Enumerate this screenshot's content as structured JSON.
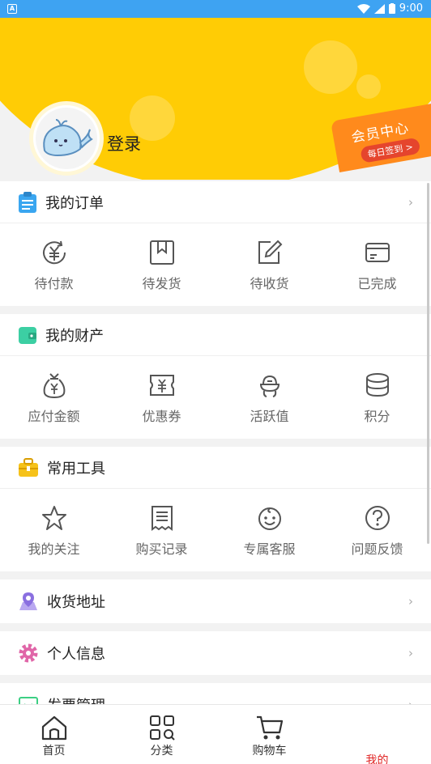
{
  "status_bar": {
    "time": "9:00"
  },
  "header": {
    "login_label": "登录",
    "vip_title": "会员中心",
    "vip_sub": "每日签到 >"
  },
  "orders": {
    "title": "我的订单",
    "items": [
      {
        "label": "待付款",
        "icon": "payment-icon"
      },
      {
        "label": "待发货",
        "icon": "package-icon"
      },
      {
        "label": "待收货",
        "icon": "edit-icon"
      },
      {
        "label": "已完成",
        "icon": "card-icon"
      }
    ]
  },
  "assets": {
    "title": "我的财产",
    "items": [
      {
        "label": "应付金额",
        "icon": "money-bag-icon"
      },
      {
        "label": "优惠券",
        "icon": "coupon-icon"
      },
      {
        "label": "活跃值",
        "icon": "activity-icon"
      },
      {
        "label": "积分",
        "icon": "coins-icon"
      }
    ]
  },
  "tools": {
    "title": "常用工具",
    "items": [
      {
        "label": "我的关注",
        "icon": "star-icon"
      },
      {
        "label": "购买记录",
        "icon": "receipt-icon"
      },
      {
        "label": "专属客服",
        "icon": "smile-icon"
      },
      {
        "label": "问题反馈",
        "icon": "question-icon"
      }
    ]
  },
  "rows": {
    "address": "收货地址",
    "personal": "个人信息",
    "invoice": "发票管理"
  },
  "tabbar": {
    "home": "首页",
    "category": "分类",
    "cart": "购物车",
    "mine": "我的"
  },
  "colors": {
    "brand_yellow": "#ffcc05",
    "active_tab": "#e02424",
    "status_bar": "#3ea3f2"
  }
}
